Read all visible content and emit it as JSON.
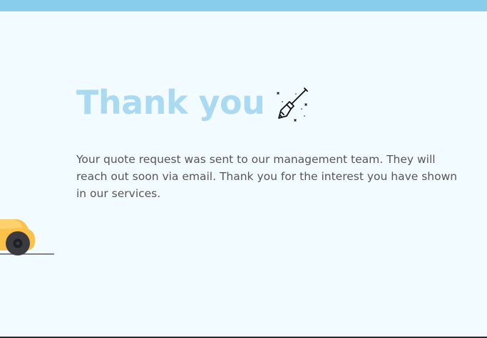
{
  "page": {
    "heading": "Thank you",
    "message": "Your quote request was sent to our management team. They will reach out soon via email. Thank you for the interest you have shown in our services."
  },
  "icons": {
    "heading_icon": "broom-sparkle-icon",
    "illustration": "car-illustration"
  },
  "colors": {
    "top_bar": "#89cdec",
    "background": "#f2fbff",
    "heading": "#a9daf1",
    "body_text": "#565656",
    "car_body": "#fbc149",
    "tire": "#3a3b40"
  }
}
